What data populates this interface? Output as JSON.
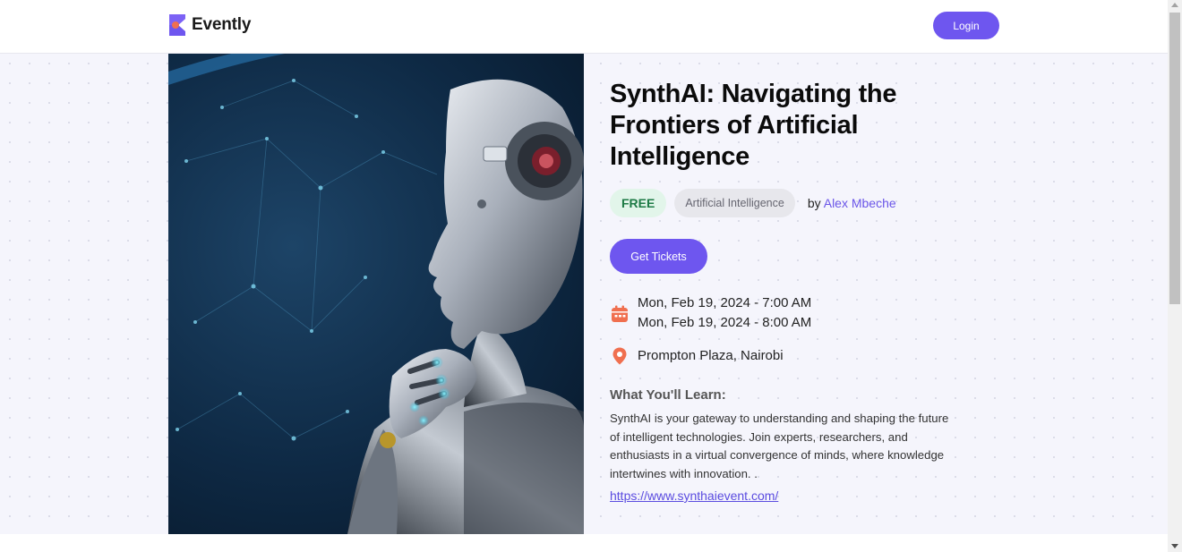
{
  "header": {
    "brand_name": "Evently",
    "login_label": "Login"
  },
  "event": {
    "title": "SynthAI: Navigating the Frontiers of Artificial Intelligence",
    "price_label": "FREE",
    "category": "Artificial Intelligence",
    "organizer_prefix": "by",
    "organizer_name": "Alex Mbeche",
    "cta_label": "Get Tickets",
    "start_datetime": "Mon, Feb 19, 2024 - 7:00 AM",
    "end_datetime": "Mon, Feb 19, 2024 - 8:00 AM",
    "location": "Prompton Plaza, Nairobi",
    "learn_heading": "What You'll Learn:",
    "description": "SynthAI is your gateway to understanding and shaping the future of intelligent technologies. Join experts, researchers, and enthusiasts in a virtual convergence of minds, where knowledge intertwines with innovation. .",
    "url": "https://www.synthaievent.com/"
  },
  "icons": {
    "brand": "evently-logo-icon",
    "date": "calendar-icon",
    "location": "location-pin-icon"
  },
  "colors": {
    "accent": "#6e56ef",
    "free_badge_bg": "#e2f5ea",
    "free_badge_text": "#1d7a45",
    "icon_orange": "#f06f4f",
    "link": "#5b4ce0"
  }
}
